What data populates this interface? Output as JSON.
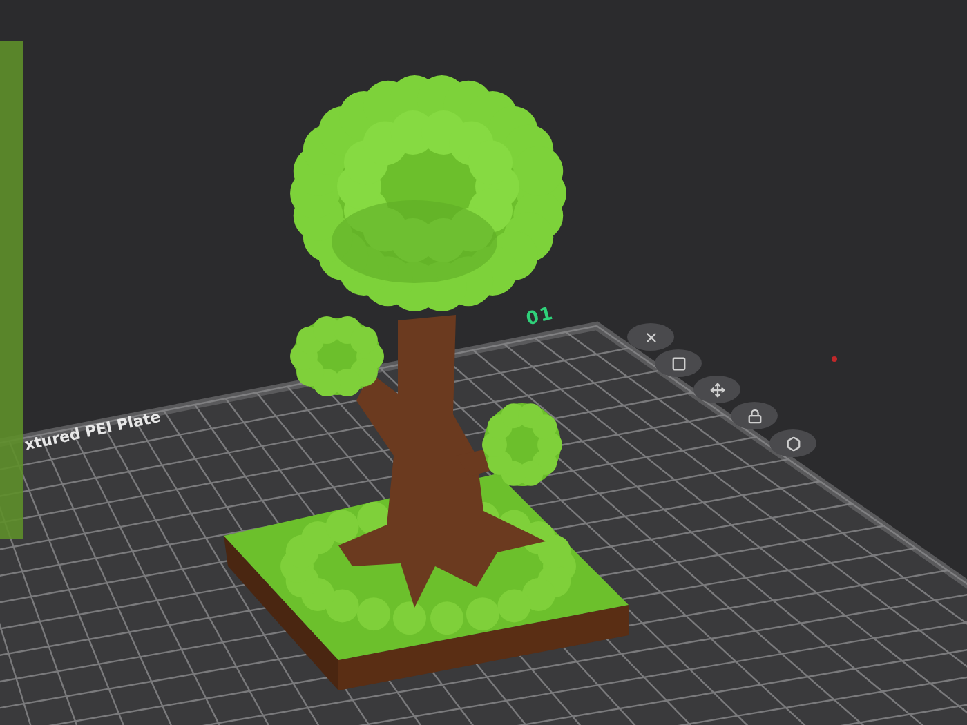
{
  "plate": {
    "number": "01",
    "name": "xtured PEI Plate"
  }
}
